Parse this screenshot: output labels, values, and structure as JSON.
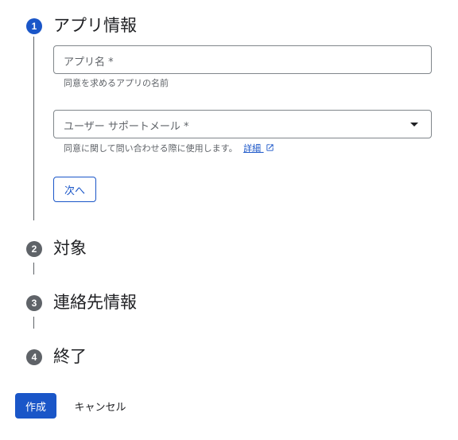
{
  "steps": [
    {
      "number": "1",
      "title": "アプリ情報",
      "state": "active"
    },
    {
      "number": "2",
      "title": "対象",
      "state": "inactive"
    },
    {
      "number": "3",
      "title": "連絡先情報",
      "state": "inactive"
    },
    {
      "number": "4",
      "title": "終了",
      "state": "inactive"
    }
  ],
  "app_info": {
    "app_name": {
      "label": "アプリ名 *",
      "value": "",
      "helper": "同意を求めるアプリの名前"
    },
    "support_email": {
      "label": "ユーザー サポートメール *",
      "value": "",
      "helper": "同意に関して問い合わせる際に使用します。",
      "link": "詳細"
    },
    "next_button": "次へ"
  },
  "footer": {
    "create_button": "作成",
    "cancel_button": "キャンセル"
  },
  "colors": {
    "primary": "#1a56c8",
    "inactive": "#5f6368",
    "border": "#80868b"
  },
  "icons": {
    "external_link": "open-in-new-icon",
    "dropdown": "arrow-drop-down-icon"
  }
}
